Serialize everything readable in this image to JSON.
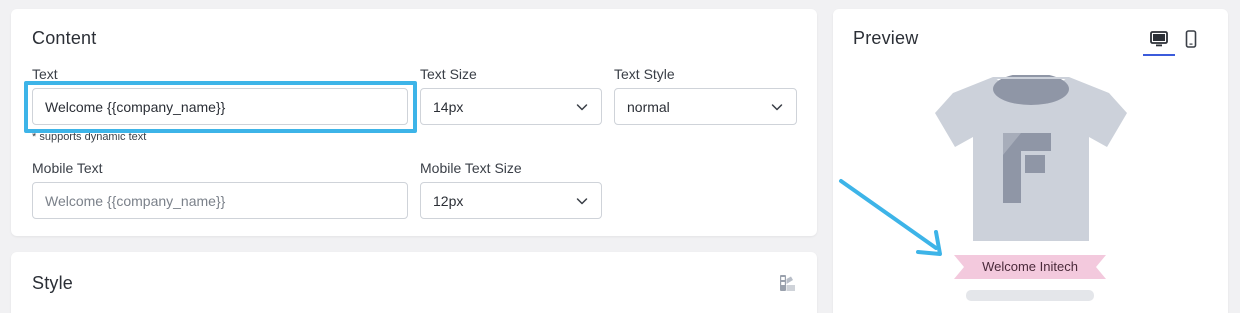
{
  "content": {
    "title": "Content",
    "text_label": "Text",
    "text_value": "Welcome {{company_name}}",
    "text_hint": "* supports dynamic text",
    "text_size_label": "Text Size",
    "text_size_value": "14px",
    "text_style_label": "Text Style",
    "text_style_value": "normal",
    "mobile_text_label": "Mobile Text",
    "mobile_text_placeholder": "Welcome {{company_name}}",
    "mobile_text_size_label": "Mobile Text Size",
    "mobile_text_size_value": "12px"
  },
  "style": {
    "title": "Style"
  },
  "preview": {
    "title": "Preview",
    "banner_text": "Welcome Initech",
    "active_tab": "desktop"
  },
  "colors": {
    "highlight": "#3db4e8",
    "tab_active": "#3b5bdb",
    "shirt": "#ccd1da",
    "shirt_logo": "#8f96a6",
    "banner": "#f3c9dd"
  },
  "icons": [
    "chevron-down-icon",
    "desktop-icon",
    "mobile-icon",
    "color-palette-icon",
    "arrow-icon"
  ]
}
